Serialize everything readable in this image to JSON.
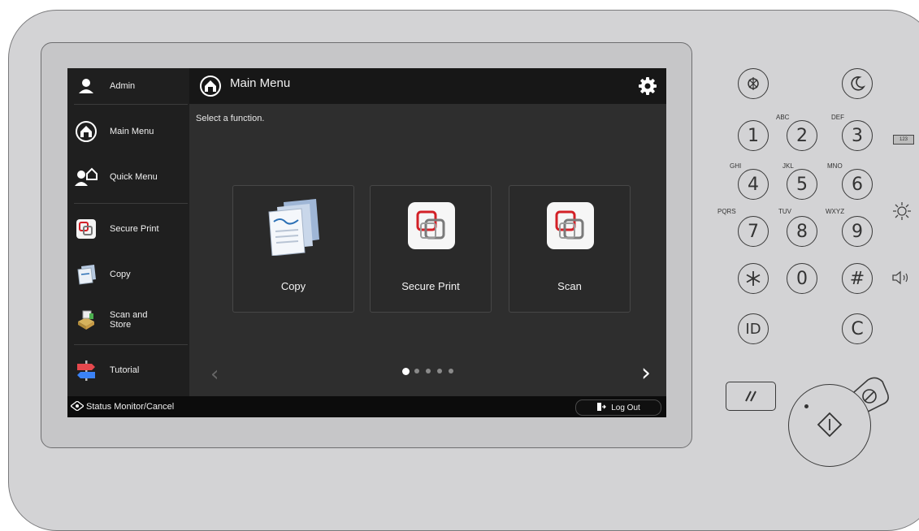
{
  "sidebar": {
    "user_label": "Admin",
    "items": [
      {
        "label": "Main Menu",
        "icon": "home-icon"
      },
      {
        "label": "Quick Menu",
        "icon": "quick-menu-icon"
      },
      {
        "label": "Secure Print",
        "icon": "secure-print-icon"
      },
      {
        "label": "Copy",
        "icon": "copy-icon"
      },
      {
        "label": "Scan and\nStore",
        "icon": "scan-and-store-icon"
      },
      {
        "label": "Tutorial",
        "icon": "signpost-icon"
      }
    ]
  },
  "header": {
    "title": "Main Menu",
    "settings_icon": "gear-icon"
  },
  "main": {
    "hint": "Select a function.",
    "tiles": [
      {
        "label": "Copy",
        "icon": "copy-icon"
      },
      {
        "label": "Secure Print",
        "icon": "secure-print-icon"
      },
      {
        "label": "Scan",
        "icon": "scan-icon"
      }
    ],
    "pagination": {
      "current_page": 1,
      "total_pages": 5
    }
  },
  "footer": {
    "status_label": "Status Monitor/Cancel",
    "logout_label": "Log Out"
  },
  "keypad": {
    "keys": [
      {
        "main": "1",
        "sub": ""
      },
      {
        "main": "2",
        "sub": "ABC"
      },
      {
        "main": "3",
        "sub": "DEF"
      },
      {
        "main": "4",
        "sub": "GHI"
      },
      {
        "main": "5",
        "sub": "JKL"
      },
      {
        "main": "6",
        "sub": "MNO"
      },
      {
        "main": "7",
        "sub": "PQRS"
      },
      {
        "main": "8",
        "sub": "TUV"
      },
      {
        "main": "9",
        "sub": "WXYZ"
      },
      {
        "main": "0",
        "sub": ""
      },
      {
        "main": "#",
        "sub": ""
      },
      {
        "main": "C",
        "sub": ""
      },
      {
        "main": "ID",
        "sub": ""
      }
    ]
  },
  "colors": {
    "screen_bg": "#2e2e2e",
    "sidebar_bg": "#1f1f1f",
    "accent_red": "#d32027",
    "panel": "#d3d3d5"
  }
}
